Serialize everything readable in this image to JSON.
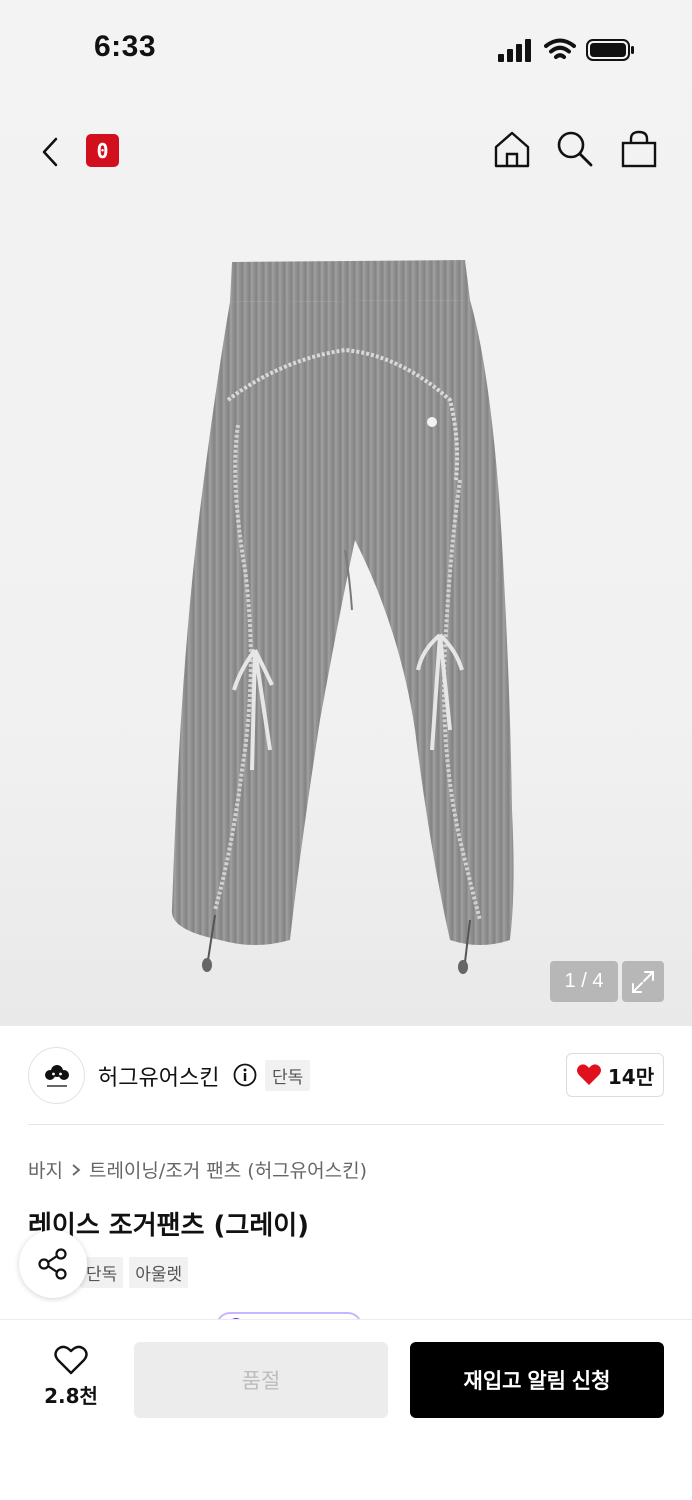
{
  "status_bar": {
    "time": "6:33"
  },
  "nav": {
    "cart_count": "0"
  },
  "gallery": {
    "page_indicator": "1 / 4"
  },
  "brand": {
    "name": "허그유어스킨",
    "tag": "단독",
    "like_count": "14만"
  },
  "breadcrumb": {
    "items": [
      "바지",
      "트레이닝/조거 팬츠 (허그유어스킨)"
    ]
  },
  "product": {
    "title": "레이스 조거팬츠 (그레이)",
    "tags": [
      "단독",
      "아울렛"
    ]
  },
  "bottom_bar": {
    "wish_count": "2.8천",
    "soldout_label": "품절",
    "restock_label": "재입고 알림 신청"
  },
  "colors": {
    "accent_red": "#d10f1d",
    "heart_red": "#e0101c",
    "pants_gray": "#8e8e8e",
    "primary_black": "#000000"
  }
}
